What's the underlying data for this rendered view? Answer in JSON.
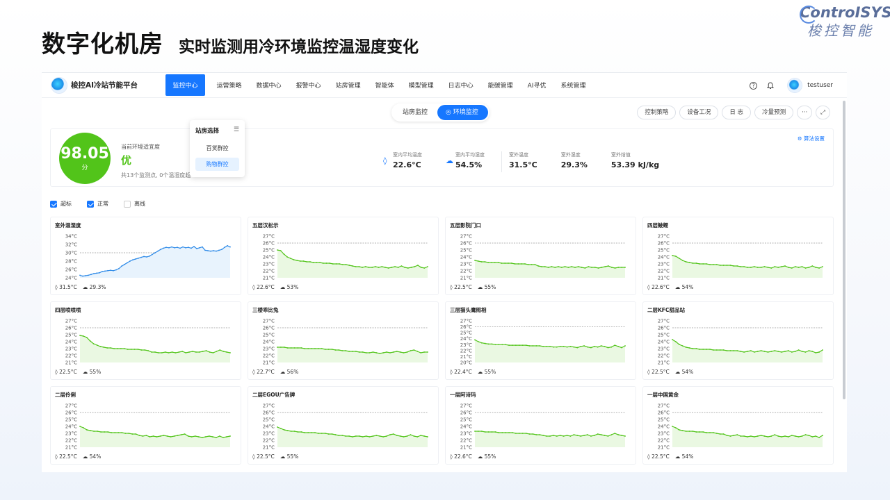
{
  "slide": {
    "title": "数字化机房",
    "subtitle": "实时监测用冷环境监控温湿度变化",
    "brand_en": "ControISYS",
    "brand_cn": "梭控智能"
  },
  "app": {
    "name": "梭控AI冷站节能平台",
    "nav": [
      "监控中心",
      "运营策略",
      "数据中心",
      "报警中心",
      "站房管理",
      "智能体",
      "模型管理",
      "日志中心",
      "能碳管理",
      "AI寻优",
      "系统管理"
    ],
    "active_nav": 0,
    "user": "testuser"
  },
  "segments": [
    "站房监控",
    "环境监控"
  ],
  "active_segment": 1,
  "tools": [
    "控制策略",
    "设备工况",
    "日 志",
    "冷量预测",
    "···",
    "⤢"
  ],
  "summary": {
    "score": "98.05",
    "score_unit": "分",
    "label": "当前环境适宜度",
    "grade": "优",
    "note": "共13个监测点, 0个温湿度超",
    "algo": "算法设置",
    "metrics": [
      {
        "icon": "thermometer-icon",
        "label": "室内平均温度",
        "value": "22.6°C"
      },
      {
        "icon": "cloud-icon",
        "label": "室内平均湿度",
        "value": "54.5%"
      },
      {
        "icon": "",
        "label": "室外温度",
        "value": "31.5°C"
      },
      {
        "icon": "",
        "label": "室外湿度",
        "value": "29.3%"
      },
      {
        "icon": "",
        "label": "室外焓值",
        "value": "53.39 kJ/kg"
      }
    ]
  },
  "dropdown": {
    "title": "站房选择",
    "options": [
      "百货群控",
      "购物群控"
    ],
    "selected": 1
  },
  "filters": [
    {
      "label": "超标",
      "checked": true
    },
    {
      "label": "正常",
      "checked": true
    },
    {
      "label": "离线",
      "checked": false
    }
  ],
  "colors": {
    "accent": "#1677ff",
    "good": "#52c41a",
    "outdoor": "#2f8be8"
  },
  "chart_data": [
    {
      "type": "line",
      "title": "室外温湿度",
      "color": "#2f8be8",
      "ylim": [
        24,
        34
      ],
      "yticks": [
        "34°C",
        "32°C",
        "30°C",
        "28°C",
        "26°C",
        "24°C"
      ],
      "threshold": 30,
      "values": [
        24.6,
        24.4,
        24.5,
        24.6,
        24.8,
        25,
        25.1,
        25.2,
        25.5,
        25.6,
        25.7,
        25.8,
        25.7,
        25.9,
        26.2,
        26.8,
        27.2,
        27.6,
        28,
        28.3,
        28.5,
        28.7,
        28.9,
        29.1,
        29,
        29.2,
        29.6,
        30,
        30.4,
        30.8,
        31.1,
        31.3,
        31.2,
        31.4,
        31.2,
        31.3,
        31.1,
        31.4,
        31.2,
        31.3,
        31.1,
        31.5,
        31,
        31.2,
        31.4,
        30.6,
        30.5,
        30.4,
        30.5,
        30.4,
        30.6,
        30.8,
        31.3,
        31.7,
        31.4
      ],
      "temp": "31.5°C",
      "hum": "29.3%"
    },
    {
      "type": "line",
      "title": "五层汉松示",
      "color": "#52c41a",
      "ylim": [
        21,
        27
      ],
      "yticks": [
        "27°C",
        "26°C",
        "25°C",
        "24°C",
        "23°C",
        "22°C",
        "21°C"
      ],
      "threshold": 26,
      "values": [
        25,
        24.9,
        24.4,
        24,
        23.8,
        23.6,
        23.5,
        23.4,
        23.4,
        23.3,
        23.3,
        23.2,
        23.2,
        23.2,
        23.1,
        23.1,
        23.1,
        23,
        23,
        23,
        22.9,
        22.9,
        22.8,
        22.7,
        22.6,
        22.6,
        22.5,
        22.6,
        22.5,
        22.5,
        22.6,
        22.5,
        22.6,
        22.5,
        22.4,
        22.5,
        22.6,
        22.5,
        22.7,
        22.5,
        22.4,
        22.5,
        22.6,
        22.8,
        22.5,
        22.4,
        22.6
      ],
      "temp": "22.6°C",
      "hum": "53%"
    },
    {
      "type": "line",
      "title": "五层影院门口",
      "color": "#52c41a",
      "ylim": [
        21,
        27
      ],
      "yticks": [
        "27°C",
        "26°C",
        "25°C",
        "24°C",
        "23°C",
        "22°C",
        "21°C"
      ],
      "threshold": 26,
      "values": [
        23.5,
        23.4,
        23.3,
        23.3,
        23.2,
        23.2,
        23.2,
        23.2,
        23.1,
        23.1,
        23.1,
        23.1,
        23,
        23,
        23,
        23,
        22.9,
        22.9,
        22.9,
        22.7,
        22.6,
        22.6,
        22.5,
        22.6,
        22.5,
        22.6,
        22.5,
        22.6,
        22.5,
        22.6,
        22.5,
        22.6,
        22.5,
        22.4,
        22.6,
        22.5,
        22.5,
        22.4,
        22.5,
        22.6,
        22.7,
        22.5,
        22.4,
        22.5,
        22.5,
        22.5
      ],
      "temp": "22.5°C",
      "hum": "55%"
    },
    {
      "type": "line",
      "title": "四层鲮鲤",
      "color": "#52c41a",
      "ylim": [
        21,
        27
      ],
      "yticks": [
        "27°C",
        "26°C",
        "25°C",
        "24°C",
        "23°C",
        "22°C",
        "21°C"
      ],
      "threshold": 26,
      "values": [
        24.2,
        24.1,
        23.8,
        23.5,
        23.3,
        23.2,
        23.1,
        23.1,
        23,
        23,
        23,
        22.9,
        22.9,
        22.9,
        22.8,
        22.8,
        22.8,
        22.8,
        22.7,
        22.7,
        22.6,
        22.6,
        22.5,
        22.5,
        22.6,
        22.5,
        22.5,
        22.6,
        22.5,
        22.4,
        22.6,
        22.5,
        22.6,
        22.7,
        22.5,
        22.4,
        22.6,
        22.5,
        22.6,
        22.4,
        22.5,
        22.7,
        22.5,
        22.4,
        22.6
      ],
      "temp": "22.6°C",
      "hum": "54%"
    },
    {
      "type": "line",
      "title": "四层喷喷喷",
      "color": "#52c41a",
      "ylim": [
        21,
        27
      ],
      "yticks": [
        "27°C",
        "26°C",
        "25°C",
        "24°C",
        "23°C",
        "22°C",
        "21°C"
      ],
      "threshold": 26,
      "values": [
        24.9,
        24.8,
        24.6,
        24.1,
        23.7,
        23.5,
        23.3,
        23.2,
        23.1,
        23.1,
        23,
        23,
        23,
        23,
        22.9,
        22.9,
        22.9,
        22.9,
        22.8,
        22.8,
        22.7,
        22.5,
        22.5,
        22.4,
        22.4,
        22.5,
        22.4,
        22.5,
        22.4,
        22.5,
        22.6,
        22.4,
        22.5,
        22.6,
        22.5,
        22.5,
        22.6,
        22.7,
        22.5,
        22.4,
        22.6,
        22.8,
        22.6,
        22.5,
        22.4
      ],
      "temp": "22.5°C",
      "hum": "55%"
    },
    {
      "type": "line",
      "title": "三楼乖比兔",
      "color": "#52c41a",
      "ylim": [
        21,
        27
      ],
      "yticks": [
        "27°C",
        "26°C",
        "25°C",
        "24°C",
        "23°C",
        "22°C",
        "21°C"
      ],
      "threshold": 26,
      "values": [
        23.2,
        23.2,
        23.2,
        23.1,
        23.1,
        23.1,
        23.1,
        23.1,
        23,
        23,
        23,
        23,
        23,
        23,
        22.9,
        22.9,
        22.9,
        22.8,
        22.8,
        22.7,
        22.7,
        22.6,
        22.6,
        22.6,
        22.5,
        22.5,
        22.4,
        22.4,
        22.5,
        22.4,
        22.3,
        22.4,
        22.5,
        22.4,
        22.5,
        22.6,
        22.5,
        22.4,
        22.5,
        22.7,
        22.8,
        22.6,
        22.4,
        22.5,
        22.5
      ],
      "temp": "22.7°C",
      "hum": "56%"
    },
    {
      "type": "line",
      "title": "三层猫头鹰照相",
      "color": "#52c41a",
      "ylim": [
        20,
        27
      ],
      "yticks": [
        "27°C",
        "26°C",
        "25°C",
        "24°C",
        "23°C",
        "22°C",
        "21°C",
        "20°C"
      ],
      "threshold": 26,
      "values": [
        23.8,
        23.5,
        23.3,
        23.2,
        23.1,
        23.1,
        23,
        23,
        23,
        23,
        22.9,
        22.9,
        22.9,
        22.9,
        22.9,
        22.9,
        22.8,
        22.8,
        22.8,
        22.8,
        22.7,
        22.7,
        22.7,
        22.6,
        22.6,
        22.7,
        22.7,
        22.6,
        22.7,
        22.6,
        22.5,
        22.7,
        22.8,
        22.6,
        22.5,
        22.7,
        22.6,
        22.8,
        22.7,
        22.5,
        22.6,
        22.9,
        22.7,
        22.5,
        22.8
      ],
      "temp": "22.4°C",
      "hum": "55%"
    },
    {
      "type": "line",
      "title": "二层KFC甜品站",
      "color": "#52c41a",
      "ylim": [
        21,
        27
      ],
      "yticks": [
        "27°C",
        "26°C",
        "25°C",
        "24°C",
        "23°C",
        "22°C",
        "21°C"
      ],
      "threshold": 26,
      "values": [
        24.3,
        24,
        23.6,
        23.4,
        23.2,
        23.1,
        23,
        23,
        22.9,
        22.9,
        22.9,
        22.9,
        22.8,
        22.8,
        22.8,
        22.8,
        22.7,
        22.7,
        22.7,
        22.7,
        22.6,
        22.5,
        22.6,
        22.7,
        22.5,
        22.6,
        22.7,
        22.6,
        22.5,
        22.6,
        22.7,
        22.6,
        22.5,
        22.6,
        22.7,
        22.5,
        22.6,
        22.8,
        22.6,
        22.5,
        22.7,
        22.6,
        22.4,
        22.5,
        22.8
      ],
      "temp": "22.5°C",
      "hum": "54%"
    },
    {
      "type": "line",
      "title": "二层伶俐",
      "color": "#52c41a",
      "ylim": [
        21,
        27
      ],
      "yticks": [
        "27°C",
        "26°C",
        "25°C",
        "24°C",
        "23°C",
        "22°C",
        "21°C"
      ],
      "threshold": 26,
      "values": [
        24,
        23.8,
        23.5,
        23.4,
        23.3,
        23.3,
        23.2,
        23.2,
        23.2,
        23.1,
        23.1,
        23.1,
        23.1,
        23,
        23,
        22.9,
        22.9,
        22.7,
        22.6,
        22.7,
        22.5,
        22.6,
        22.5,
        22.6,
        22.7,
        22.6,
        22.5,
        22.6,
        22.7,
        22.8,
        22.9,
        22.6,
        22.5,
        22.6,
        22.5,
        22.4,
        22.5,
        22.6,
        22.5,
        22.4,
        22.6,
        22.4,
        22.5,
        22.6
      ],
      "temp": "22.5°C",
      "hum": "54%"
    },
    {
      "type": "line",
      "title": "二层EGOU广告牌",
      "color": "#52c41a",
      "ylim": [
        21,
        27
      ],
      "yticks": [
        "27°C",
        "26°C",
        "25°C",
        "24°C",
        "23°C",
        "22°C",
        "21°C"
      ],
      "threshold": 26,
      "values": [
        23.9,
        23.7,
        23.5,
        23.4,
        23.3,
        23.3,
        23.2,
        23.2,
        23.1,
        23.1,
        23.1,
        23.1,
        23,
        23,
        23,
        22.9,
        22.9,
        22.8,
        22.7,
        22.7,
        22.6,
        22.6,
        22.5,
        22.6,
        22.6,
        22.5,
        22.6,
        22.5,
        22.6,
        22.7,
        22.6,
        22.5,
        22.6,
        22.8,
        22.9,
        22.7,
        22.6,
        22.5,
        22.6,
        22.8,
        22.6,
        22.5,
        22.7,
        22.6,
        22.5
      ],
      "temp": "22.5°C",
      "hum": "55%"
    },
    {
      "type": "line",
      "title": "一层阿诗玛",
      "color": "#52c41a",
      "ylim": [
        21,
        27
      ],
      "yticks": [
        "27°C",
        "26°C",
        "25°C",
        "24°C",
        "23°C",
        "22°C",
        "21°C"
      ],
      "threshold": 26,
      "values": [
        23.3,
        23.3,
        23.3,
        23.2,
        23.2,
        23.2,
        23.2,
        23.1,
        23.1,
        23.1,
        23.1,
        23.1,
        23,
        23,
        23,
        23,
        22.9,
        22.9,
        22.8,
        22.8,
        22.7,
        22.6,
        22.6,
        22.7,
        22.6,
        22.7,
        22.6,
        22.7,
        22.6,
        22.8,
        22.7,
        22.6,
        22.7,
        22.8,
        22.6,
        22.7,
        22.9,
        22.8,
        22.7,
        22.6,
        22.8,
        23,
        22.8,
        22.7,
        22.6
      ],
      "temp": "22.6°C",
      "hum": "55%"
    },
    {
      "type": "line",
      "title": "一层中国黄金",
      "color": "#52c41a",
      "ylim": [
        21,
        27
      ],
      "yticks": [
        "27°C",
        "26°C",
        "25°C",
        "24°C",
        "23°C",
        "22°C",
        "21°C"
      ],
      "threshold": 26,
      "values": [
        24,
        23.8,
        23.5,
        23.4,
        23.3,
        23.3,
        23.3,
        23.2,
        23.2,
        23.2,
        23.1,
        23.1,
        23.1,
        23,
        22.9,
        22.9,
        22.7,
        22.6,
        22.7,
        22.8,
        22.6,
        22.6,
        22.5,
        22.6,
        22.5,
        22.6,
        22.7,
        22.6,
        22.5,
        22.6,
        22.8,
        22.6,
        22.5,
        22.6,
        22.5,
        22.7,
        22.6,
        22.5,
        22.6,
        22.8,
        22.7,
        22.5,
        22.6,
        22.4,
        22.7
      ],
      "temp": "22.5°C",
      "hum": "54%"
    }
  ]
}
